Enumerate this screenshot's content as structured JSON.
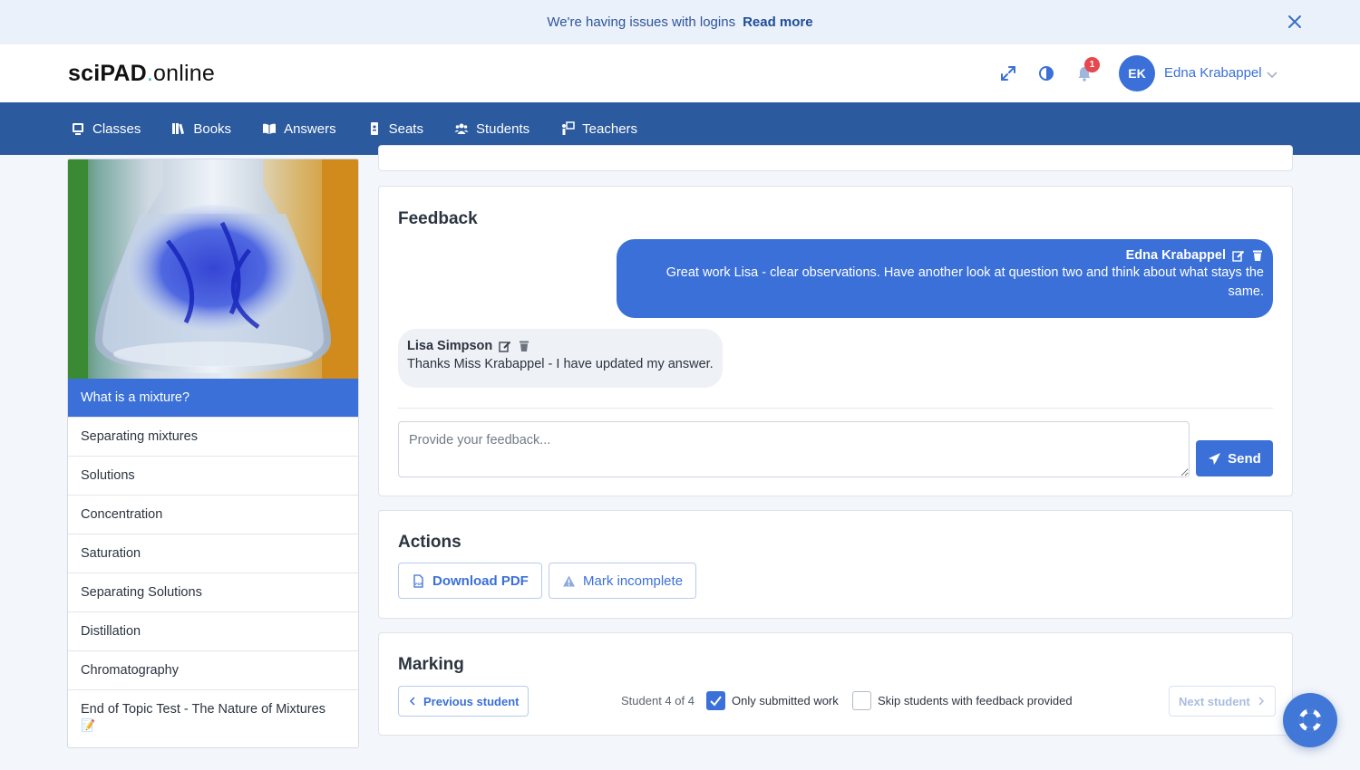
{
  "banner": {
    "message": "We're having issues with logins",
    "link": "Read more"
  },
  "brand": {
    "part1": "sciPAD",
    "dot": ".",
    "part2": "online"
  },
  "header": {
    "notification_count": "1",
    "user": {
      "initials": "EK",
      "name": "Edna Krabappel"
    }
  },
  "nav": {
    "items": [
      {
        "label": "Classes",
        "icon": "monitor-icon"
      },
      {
        "label": "Books",
        "icon": "books-icon"
      },
      {
        "label": "Answers",
        "icon": "open-book-icon"
      },
      {
        "label": "Seats",
        "icon": "id-card-icon"
      },
      {
        "label": "Students",
        "icon": "users-icon"
      },
      {
        "label": "Teachers",
        "icon": "teacher-icon"
      }
    ]
  },
  "sidebar": {
    "items": [
      {
        "label": "What is a mixture?"
      },
      {
        "label": "Separating mixtures"
      },
      {
        "label": "Solutions"
      },
      {
        "label": "Concentration"
      },
      {
        "label": "Saturation"
      },
      {
        "label": "Separating Solutions"
      },
      {
        "label": "Distillation"
      },
      {
        "label": "Chromatography"
      },
      {
        "label": "End of Topic Test - The Nature of Mixtures",
        "emoji": "📝"
      }
    ]
  },
  "feedback": {
    "title": "Feedback",
    "messages": [
      {
        "author": "Edna Krabappel",
        "text": "Great work Lisa - clear observations. Have another look at question two and think about what stays the same."
      },
      {
        "author": "Lisa Simpson",
        "text": "Thanks Miss Krabappel - I have updated my answer."
      }
    ],
    "input_placeholder": "Provide your feedback...",
    "send_label": "Send"
  },
  "actions": {
    "title": "Actions",
    "download_label": "Download PDF",
    "mark_incomplete_label": "Mark incomplete"
  },
  "marking": {
    "title": "Marking",
    "previous_label": "Previous student",
    "student_count": "Student 4 of 4",
    "only_submitted_label": "Only submitted work",
    "only_submitted_checked": true,
    "skip_feedback_label": "Skip students with feedback provided",
    "skip_feedback_checked": false,
    "next_label": "Next student"
  },
  "colors": {
    "primary": "#3a70d8",
    "nav": "#2b5a9e",
    "banner_bg": "#eaf1fb",
    "badge": "#e5484d"
  }
}
